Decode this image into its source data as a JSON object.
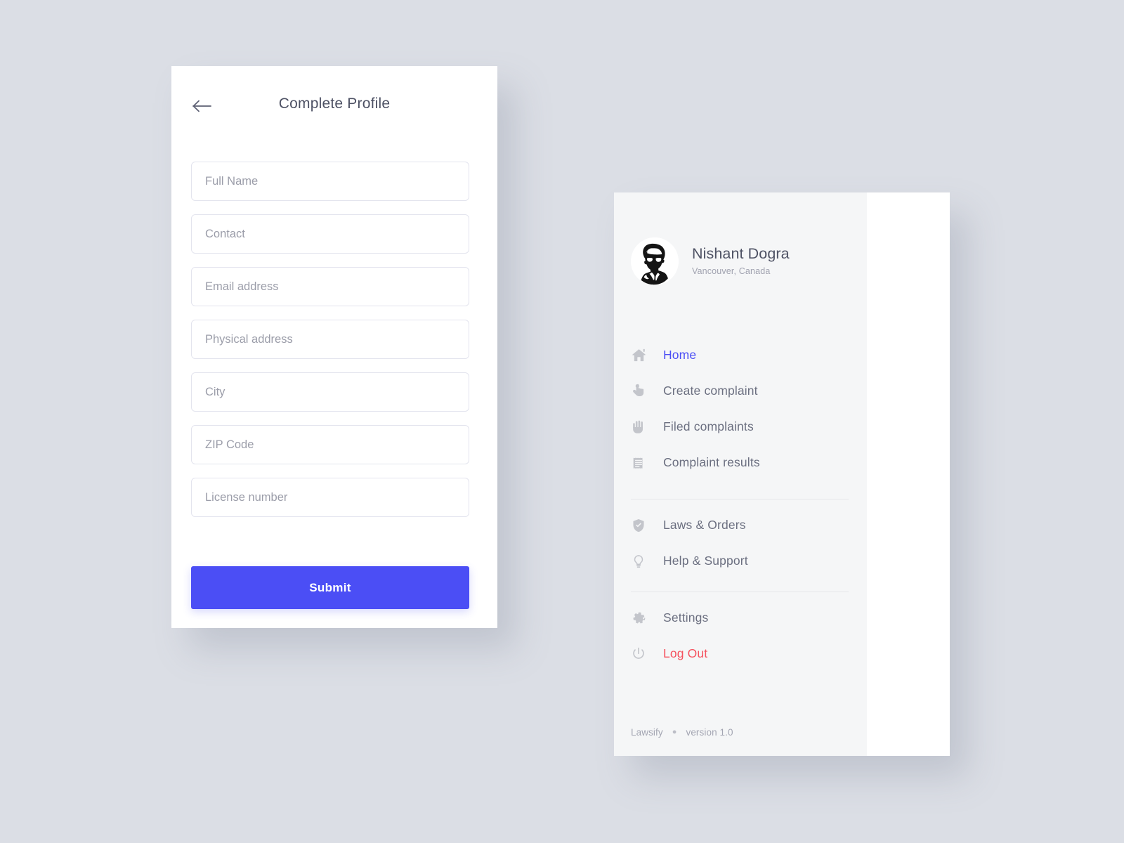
{
  "theme": {
    "page_background": "#dbdee5",
    "accent": "#4b4ef5",
    "danger": "#f5525f",
    "card_background": "#ffffff",
    "drawer_background": "#f5f6f7",
    "field_border": "#e3e4ee",
    "placeholder_color": "#9b9da9"
  },
  "profile_screen": {
    "back_icon": "arrow-left-icon",
    "title": "Complete Profile",
    "fields": [
      {
        "name": "full-name",
        "placeholder": "Full Name",
        "value": ""
      },
      {
        "name": "contact",
        "placeholder": "Contact",
        "value": ""
      },
      {
        "name": "email",
        "placeholder": "Email address",
        "value": ""
      },
      {
        "name": "physical-address",
        "placeholder": "Physical address",
        "value": ""
      },
      {
        "name": "city",
        "placeholder": "City",
        "value": ""
      },
      {
        "name": "zip",
        "placeholder": "ZIP Code",
        "value": ""
      },
      {
        "name": "license-number",
        "placeholder": "License number",
        "value": ""
      }
    ],
    "submit_label": "Submit"
  },
  "drawer_screen": {
    "user": {
      "avatar_icon": "user-portrait-avatar",
      "name": "Nishant Dogra",
      "location": "Vancouver, Canada"
    },
    "groups": [
      {
        "items": [
          {
            "icon": "home-icon",
            "label": "Home",
            "state": "active"
          },
          {
            "icon": "pointing-hand-icon",
            "label": "Create complaint",
            "state": "normal"
          },
          {
            "icon": "open-hand-icon",
            "label": "Filed complaints",
            "state": "normal"
          },
          {
            "icon": "receipt-icon",
            "label": "Complaint results",
            "state": "normal"
          }
        ]
      },
      {
        "items": [
          {
            "icon": "shield-check-icon",
            "label": "Laws & Orders",
            "state": "normal"
          },
          {
            "icon": "lightbulb-icon",
            "label": "Help & Support",
            "state": "normal"
          }
        ]
      },
      {
        "items": [
          {
            "icon": "gear-icon",
            "label": "Settings",
            "state": "normal"
          },
          {
            "icon": "power-icon",
            "label": "Log Out",
            "state": "danger"
          }
        ]
      }
    ],
    "footer": {
      "app_name": "Lawsify",
      "separator": "●",
      "version": "version 1.0"
    }
  }
}
